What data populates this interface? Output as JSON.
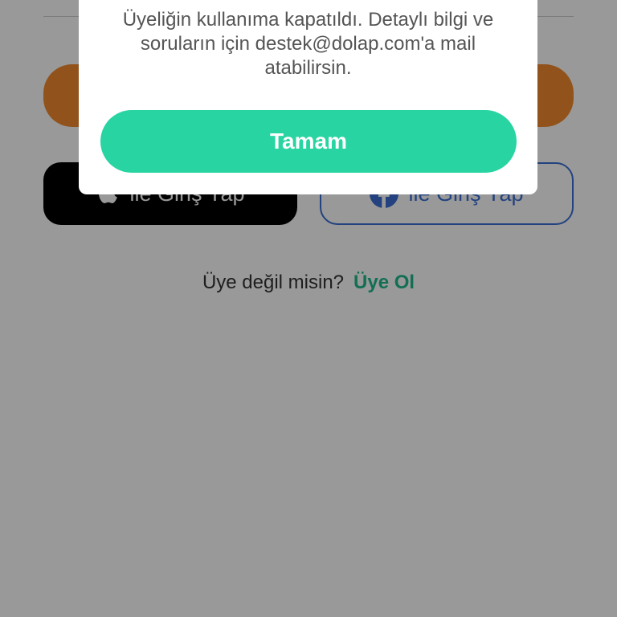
{
  "login": {
    "apple_label": "ile Giriş Yap",
    "facebook_label": "ile Giriş Yap"
  },
  "signup": {
    "prompt": "Üye değil misin?",
    "link": "Üye Ol"
  },
  "dialog": {
    "message": "Üyeliğin kullanıma kapatıldı. Detaylı bilgi ve soruların için destek@dolap.com'a mail atabilirsin.",
    "ok_label": "Tamam"
  },
  "colors": {
    "accent": "#27d4a2",
    "link": "#1fb98c",
    "orange": "#f28a2e",
    "facebook": "#3b6fd4"
  }
}
